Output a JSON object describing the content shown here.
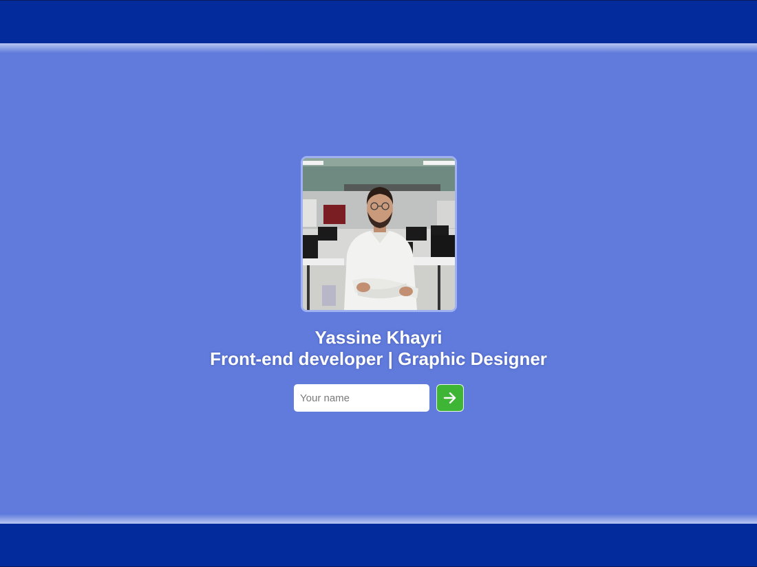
{
  "profile": {
    "name": "Yassine Khayri",
    "role": "Front-end developer | Graphic Designer",
    "photo_icon": "profile-photo"
  },
  "form": {
    "name_placeholder": "Your name",
    "name_value": "",
    "submit_icon": "arrow-right-icon"
  },
  "colors": {
    "background": "#617bdc",
    "bars": "#042b9b",
    "button": "#3fb536",
    "text": "#ffffff"
  }
}
